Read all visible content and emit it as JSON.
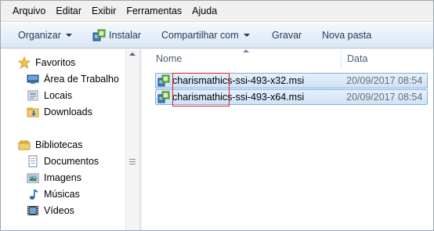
{
  "menubar": {
    "items": [
      "Arquivo",
      "Editar",
      "Exibir",
      "Ferramentas",
      "Ajuda"
    ]
  },
  "toolbar": {
    "organize_label": "Organizar",
    "install_label": "Instalar",
    "share_label": "Compartilhar com",
    "burn_label": "Gravar",
    "new_folder_label": "Nova pasta"
  },
  "navigation": {
    "favorites": {
      "label": "Favoritos",
      "items": [
        "Área de Trabalho",
        "Locais",
        "Downloads"
      ]
    },
    "libraries": {
      "label": "Bibliotecas",
      "items": [
        "Documentos",
        "Imagens",
        "Músicas",
        "Vídeos"
      ]
    }
  },
  "columns": {
    "name": "Nome",
    "date": "Data"
  },
  "files": [
    {
      "name": "charismathics-ssi-493-x32.msi",
      "date": "20/09/2017 08:54"
    },
    {
      "name": "charismathics-ssi-493-x64.msi",
      "date": "20/09/2017 08:54"
    }
  ],
  "colors": {
    "selection": "#cde3f7",
    "selection_border": "#84acdd",
    "highlight_box": "#e02020",
    "toolbar_text": "#1e395b"
  }
}
